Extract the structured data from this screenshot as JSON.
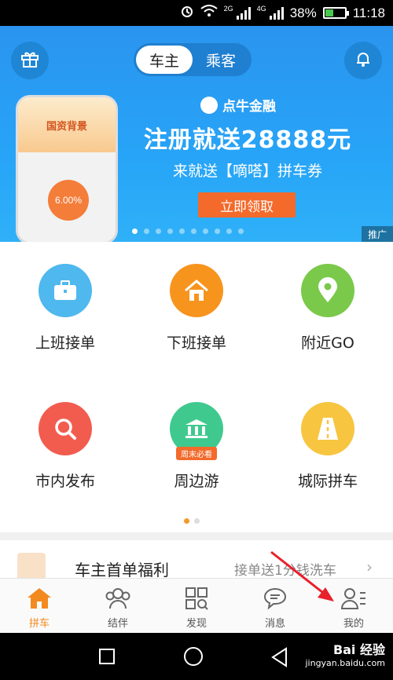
{
  "status_bar": {
    "network_small": "2G",
    "network_4g": "4G",
    "battery_percent": "38%",
    "time": "11:18",
    "icons": [
      "alarm-icon",
      "wifi-icon",
      "signal-icon",
      "battery-icon"
    ]
  },
  "header": {
    "toggle": [
      {
        "label": "车主",
        "active": true
      },
      {
        "label": "乘客",
        "active": false
      }
    ],
    "left_icon": "gift-icon",
    "right_icon": "bell-icon"
  },
  "banner": {
    "brand": "点牛金融",
    "headline": "注册就送28888元",
    "subline": "来就送【嘀嗒】拼车券",
    "button": "立即领取",
    "ad_tag": "推广",
    "mock_title": "国资背景",
    "mock_rate": "6.00%"
  },
  "grid": {
    "items": [
      {
        "label": "上班接单",
        "icon": "briefcase-icon",
        "color": "#4fb8ee"
      },
      {
        "label": "下班接单",
        "icon": "home-icon",
        "color": "#f7941d"
      },
      {
        "label": "附近GO",
        "icon": "location-icon",
        "color": "#7bc94a"
      },
      {
        "label": "市内发布",
        "icon": "search-icon",
        "color": "#f25c4f"
      },
      {
        "label": "周边游",
        "icon": "landmark-icon",
        "color": "#3fc98e",
        "badge": "周末必看"
      },
      {
        "label": "城际拼车",
        "icon": "road-icon",
        "color": "#f7c540"
      }
    ]
  },
  "promo": {
    "title": "车主首单福利",
    "link": "接单送1分钱洗车"
  },
  "tabs": [
    {
      "label": "拼车",
      "icon": "home-icon",
      "active": true
    },
    {
      "label": "结伴",
      "icon": "group-icon",
      "active": false
    },
    {
      "label": "发现",
      "icon": "grid-icon",
      "active": false
    },
    {
      "label": "消息",
      "icon": "chat-icon",
      "active": false
    },
    {
      "label": "我的",
      "icon": "profile-icon",
      "active": false
    }
  ],
  "watermark": {
    "brand": "Bai 经验",
    "url": "jingyan.baidu.com"
  },
  "colors": {
    "accent": "#f38a1f",
    "banner_blue": "#27a4f7",
    "annotation_red": "#e8202a"
  }
}
